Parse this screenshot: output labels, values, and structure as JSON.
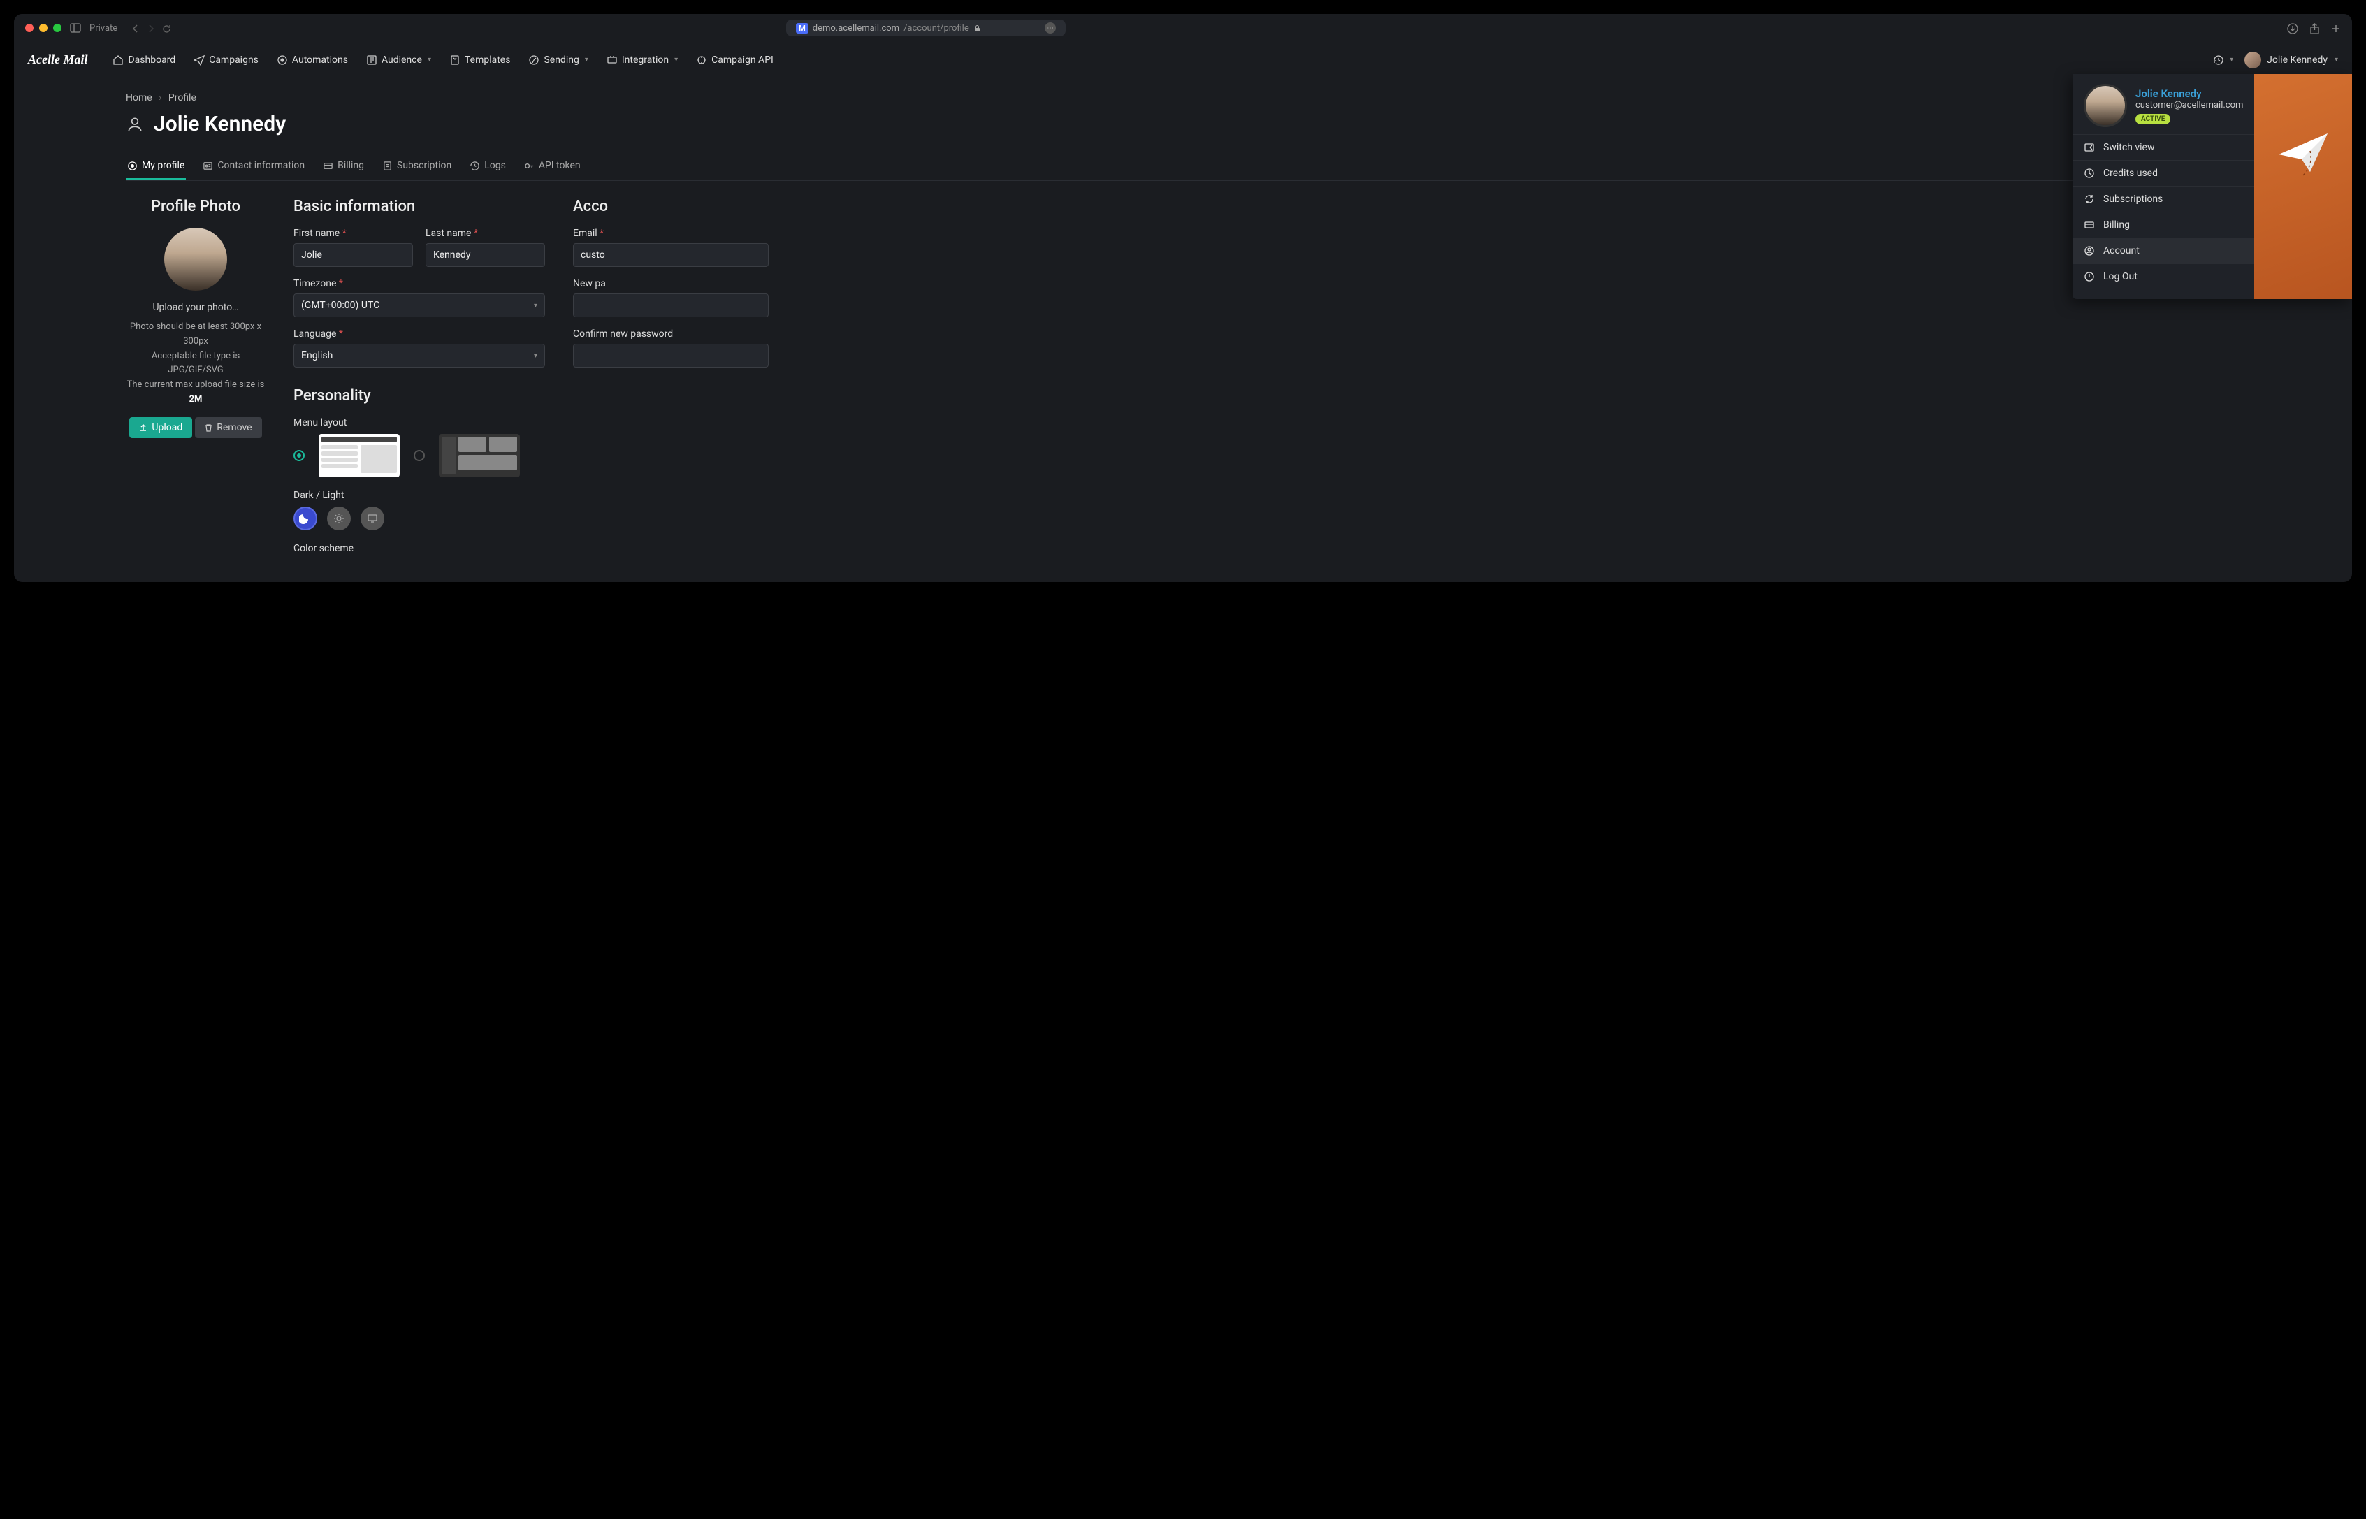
{
  "titlebar": {
    "private_label": "Private",
    "url_host": "demo.acellemail.com",
    "url_path": "/account/profile"
  },
  "brand": "Acelle Mail",
  "nav": {
    "dashboard": "Dashboard",
    "campaigns": "Campaigns",
    "automations": "Automations",
    "audience": "Audience",
    "templates": "Templates",
    "sending": "Sending",
    "integration": "Integration",
    "campaign_api": "Campaign API",
    "user_name": "Jolie Kennedy"
  },
  "breadcrumb": {
    "home": "Home",
    "current": "Profile"
  },
  "page_title": "Jolie Kennedy",
  "tabs": {
    "my_profile": "My profile",
    "contact": "Contact information",
    "billing": "Billing",
    "subscription": "Subscription",
    "logs": "Logs",
    "api_token": "API token"
  },
  "photo": {
    "heading": "Profile Photo",
    "upload_hint": "Upload your photo…",
    "req1": "Photo should be at least 300px x 300px",
    "req2": "Acceptable file type is JPG/GIF/SVG",
    "req3_pre": "The current max upload file size is ",
    "req3_bold": "2M",
    "upload_btn": "Upload",
    "remove_btn": "Remove"
  },
  "basic": {
    "heading": "Basic information",
    "first_name_label": "First name",
    "first_name_value": "Jolie",
    "last_name_label": "Last name",
    "last_name_value": "Kennedy",
    "timezone_label": "Timezone",
    "timezone_value": "(GMT+00:00) UTC",
    "language_label": "Language",
    "language_value": "English"
  },
  "account": {
    "heading": "Acco",
    "email_label": "Email",
    "email_value": "custo",
    "new_pw_label": "New pa",
    "confirm_pw_label": "Confirm new password"
  },
  "personality": {
    "heading": "Personality",
    "menu_layout_label": "Menu layout",
    "dark_light_label": "Dark / Light",
    "color_scheme_label": "Color scheme"
  },
  "dropdown": {
    "name": "Jolie Kennedy",
    "email": "customer@acellemail.com",
    "status": "ACTIVE",
    "switch_view": "Switch view",
    "credits": "Credits used",
    "subscriptions": "Subscriptions",
    "billing": "Billing",
    "account": "Account",
    "logout": "Log Out"
  }
}
